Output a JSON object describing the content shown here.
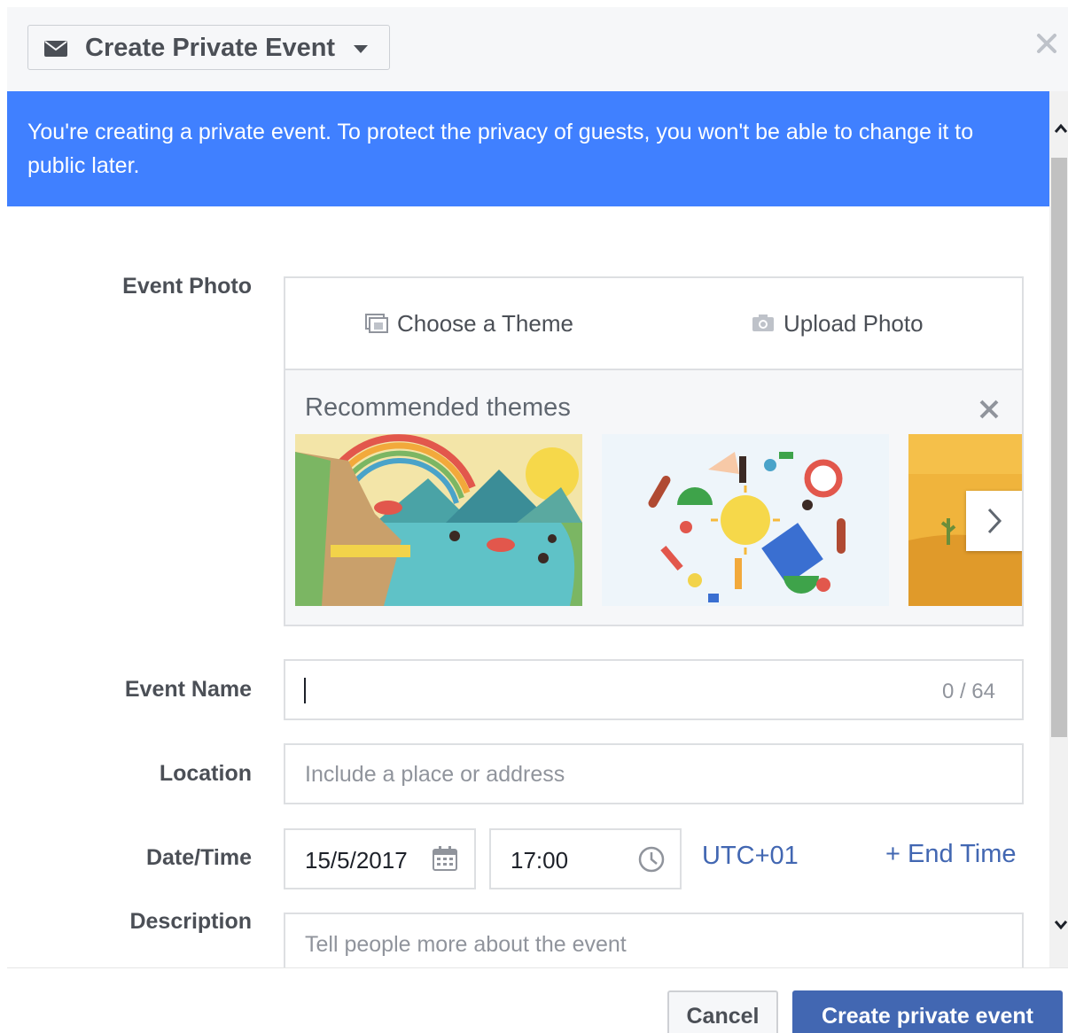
{
  "header": {
    "title": "Create Private Event",
    "icon": "envelope-icon"
  },
  "notice": {
    "text": "You're creating a private event. To protect the privacy of guests, you won't be able to change it to public later."
  },
  "form": {
    "event_photo": {
      "label": "Event Photo",
      "tabs": [
        {
          "label": "Choose a Theme",
          "icon": "theme-icon"
        },
        {
          "label": "Upload Photo",
          "icon": "camera-icon"
        }
      ],
      "recommended_title": "Recommended themes"
    },
    "event_name": {
      "label": "Event Name",
      "value": "",
      "counter": "0 / 64"
    },
    "location": {
      "label": "Location",
      "placeholder": "Include a place or address"
    },
    "datetime": {
      "label": "Date/Time",
      "date": "15/5/2017",
      "time": "17:00",
      "timezone": "UTC+01",
      "end_time_link": "+ End Time"
    },
    "description": {
      "label": "Description",
      "placeholder": "Tell people more about the event"
    }
  },
  "footer": {
    "cancel_label": "Cancel",
    "create_label": "Create private event"
  },
  "colors": {
    "notice_bg": "#4080ff",
    "primary_button": "#4267b2",
    "link": "#4267b2"
  }
}
